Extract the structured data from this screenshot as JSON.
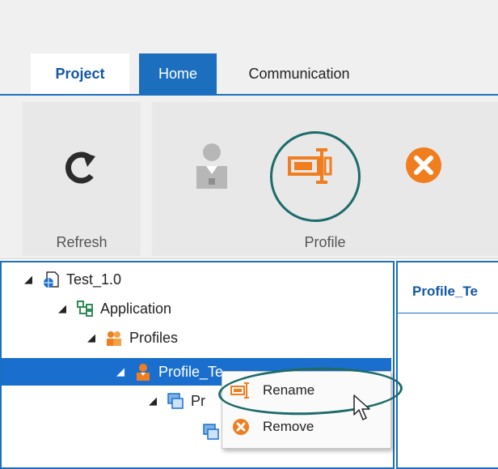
{
  "tabs": {
    "project": "Project",
    "home": "Home",
    "communication": "Communication"
  },
  "ribbon": {
    "refresh_group_label": "Refresh",
    "profile_group_label": "Profile",
    "icons": [
      "refresh-icon",
      "add-profile-icon",
      "rename-icon",
      "remove-icon"
    ]
  },
  "tree": {
    "root": "Test_1.0",
    "application": "Application",
    "profiles": "Profiles",
    "selected_item": "Profile_Te",
    "child_item": "Pr"
  },
  "right_panel": {
    "title": "Profile_Te"
  },
  "context_menu": {
    "rename": "Rename",
    "remove": "Remove"
  },
  "colors": {
    "accent_blue": "#1c6fbf",
    "selection_blue": "#1a6fce",
    "orange": "#f07d1e",
    "highlight_teal": "#1d6b6b"
  }
}
